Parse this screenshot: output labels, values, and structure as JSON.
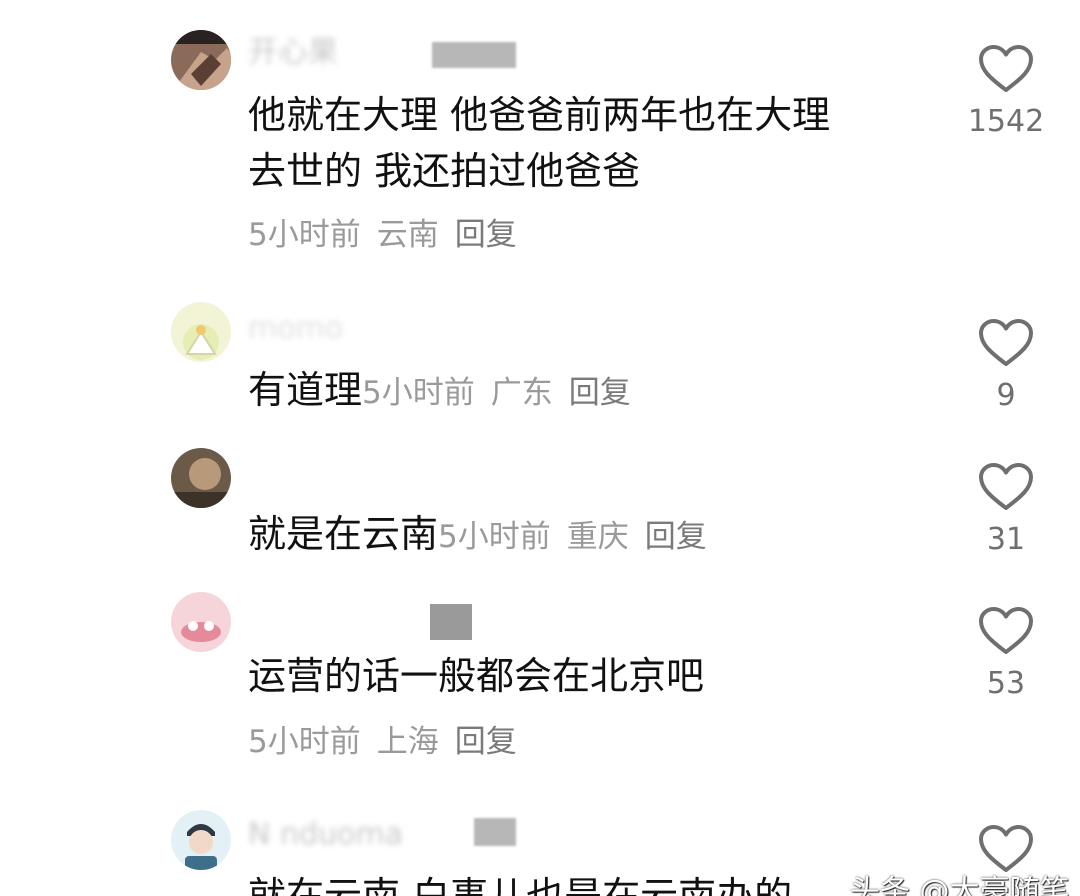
{
  "comments": [
    {
      "username": "开心果",
      "text_line1": "他就在大理 他爸爸前两年也在大理",
      "text_line2": "去世的 我还拍过他爸爸",
      "time": "5小时前",
      "location": "云南",
      "reply": "回复",
      "likes": "1542"
    },
    {
      "username": "momo",
      "text": "有道理",
      "time": "5小时前",
      "location": "广东",
      "reply": "回复",
      "likes": "9"
    },
    {
      "username": "",
      "text": "就是在云南",
      "time": "5小时前",
      "location": "重庆",
      "reply": "回复",
      "likes": "31"
    },
    {
      "username": "",
      "text": "运营的话一般都会在北京吧",
      "time": "5小时前",
      "location": "上海",
      "reply": "回复",
      "likes": "53"
    },
    {
      "username": "N    nduoma",
      "text": "就在云南 白事儿也是在云南办的",
      "likes": ""
    }
  ],
  "watermark": "头条 @大豪随笔",
  "colors": {
    "text": "#111111",
    "meta": "#9a9a9a",
    "heart_stroke": "#6f6f6f",
    "background": "#ffffff"
  },
  "icons": {
    "like": "heart-outline-icon"
  }
}
